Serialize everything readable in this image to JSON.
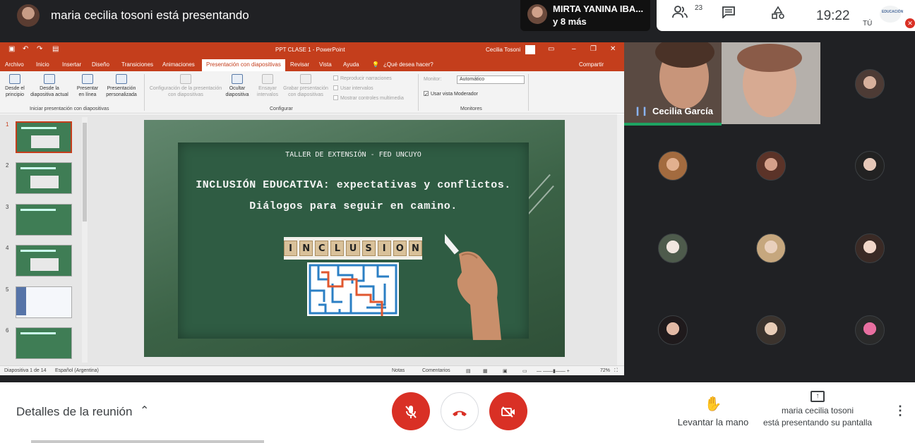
{
  "header": {
    "presenting_text": "maria cecilia tosoni está presentando",
    "speaker_name": "MIRTA YANINA IBA...",
    "speaker_more": "y 8 más",
    "people_count": "23",
    "clock": "19:22",
    "self_label": "TÚ",
    "self_logo_text": "EDUCACIÓN"
  },
  "powerpoint": {
    "title": "PPT CLASE 1  -  PowerPoint",
    "user": "Cecilia Tosoni",
    "tabs": [
      "Archivo",
      "Inicio",
      "Insertar",
      "Diseño",
      "Transiciones",
      "Animaciones",
      "Presentación con diapositivas",
      "Revisar",
      "Vista",
      "Ayuda"
    ],
    "tell_me": "¿Qué desea hacer?",
    "share": "Compartir",
    "ribbon": {
      "from_start": "Desde el principio",
      "from_current": "Desde la diapositiva actual",
      "present_online": "Presentar en línea",
      "custom_show": "Presentación personalizada",
      "group_start": "Iniciar presentación con diapositivas",
      "setup": "Configuración de la presentación con diapositivas",
      "hide_slide": "Ocultar diapositiva",
      "rehearse": "Ensayar intervalos",
      "record": "Grabar presentación con diapositivas",
      "play_narrations": "Reproducir narraciones",
      "use_timings": "Usar intervalos",
      "show_media": "Mostrar controles multimedia",
      "group_configure": "Configurar",
      "monitor_label": "Monitor:",
      "monitor_value": "Automático",
      "presenter_view": "Usar vista Moderador",
      "group_monitors": "Monitores"
    },
    "thumbnails": [
      "1",
      "2",
      "3",
      "4",
      "5",
      "6"
    ],
    "slide": {
      "header": "TALLER DE EXTENSIÓN - FED UNCUYO",
      "title_line1": "INCLUSIÓN EDUCATIVA: expectativas y conflictos.",
      "title_line2": "Diálogos para seguir en camino.",
      "tiles": [
        "I",
        "N",
        "C",
        "L",
        "U",
        "S",
        "I",
        "O",
        "N"
      ]
    },
    "status": {
      "slide_count": "Diapositiva 1 de 14",
      "language": "Español (Argentina)",
      "notes": "Notas",
      "comments": "Comentarios",
      "zoom": "72%"
    }
  },
  "participants": {
    "featured_name": "Cecilia García"
  },
  "bottom": {
    "details": "Detalles de la reunión",
    "raise_hand": "Levantar la mano",
    "presenting_line1": "maria cecilia tosoni",
    "presenting_line2": "está presentando su pantalla"
  },
  "colors": {
    "ppt_accent": "#c43e1c",
    "meet_red": "#d93025",
    "chalkboard": "#2f5c43"
  }
}
